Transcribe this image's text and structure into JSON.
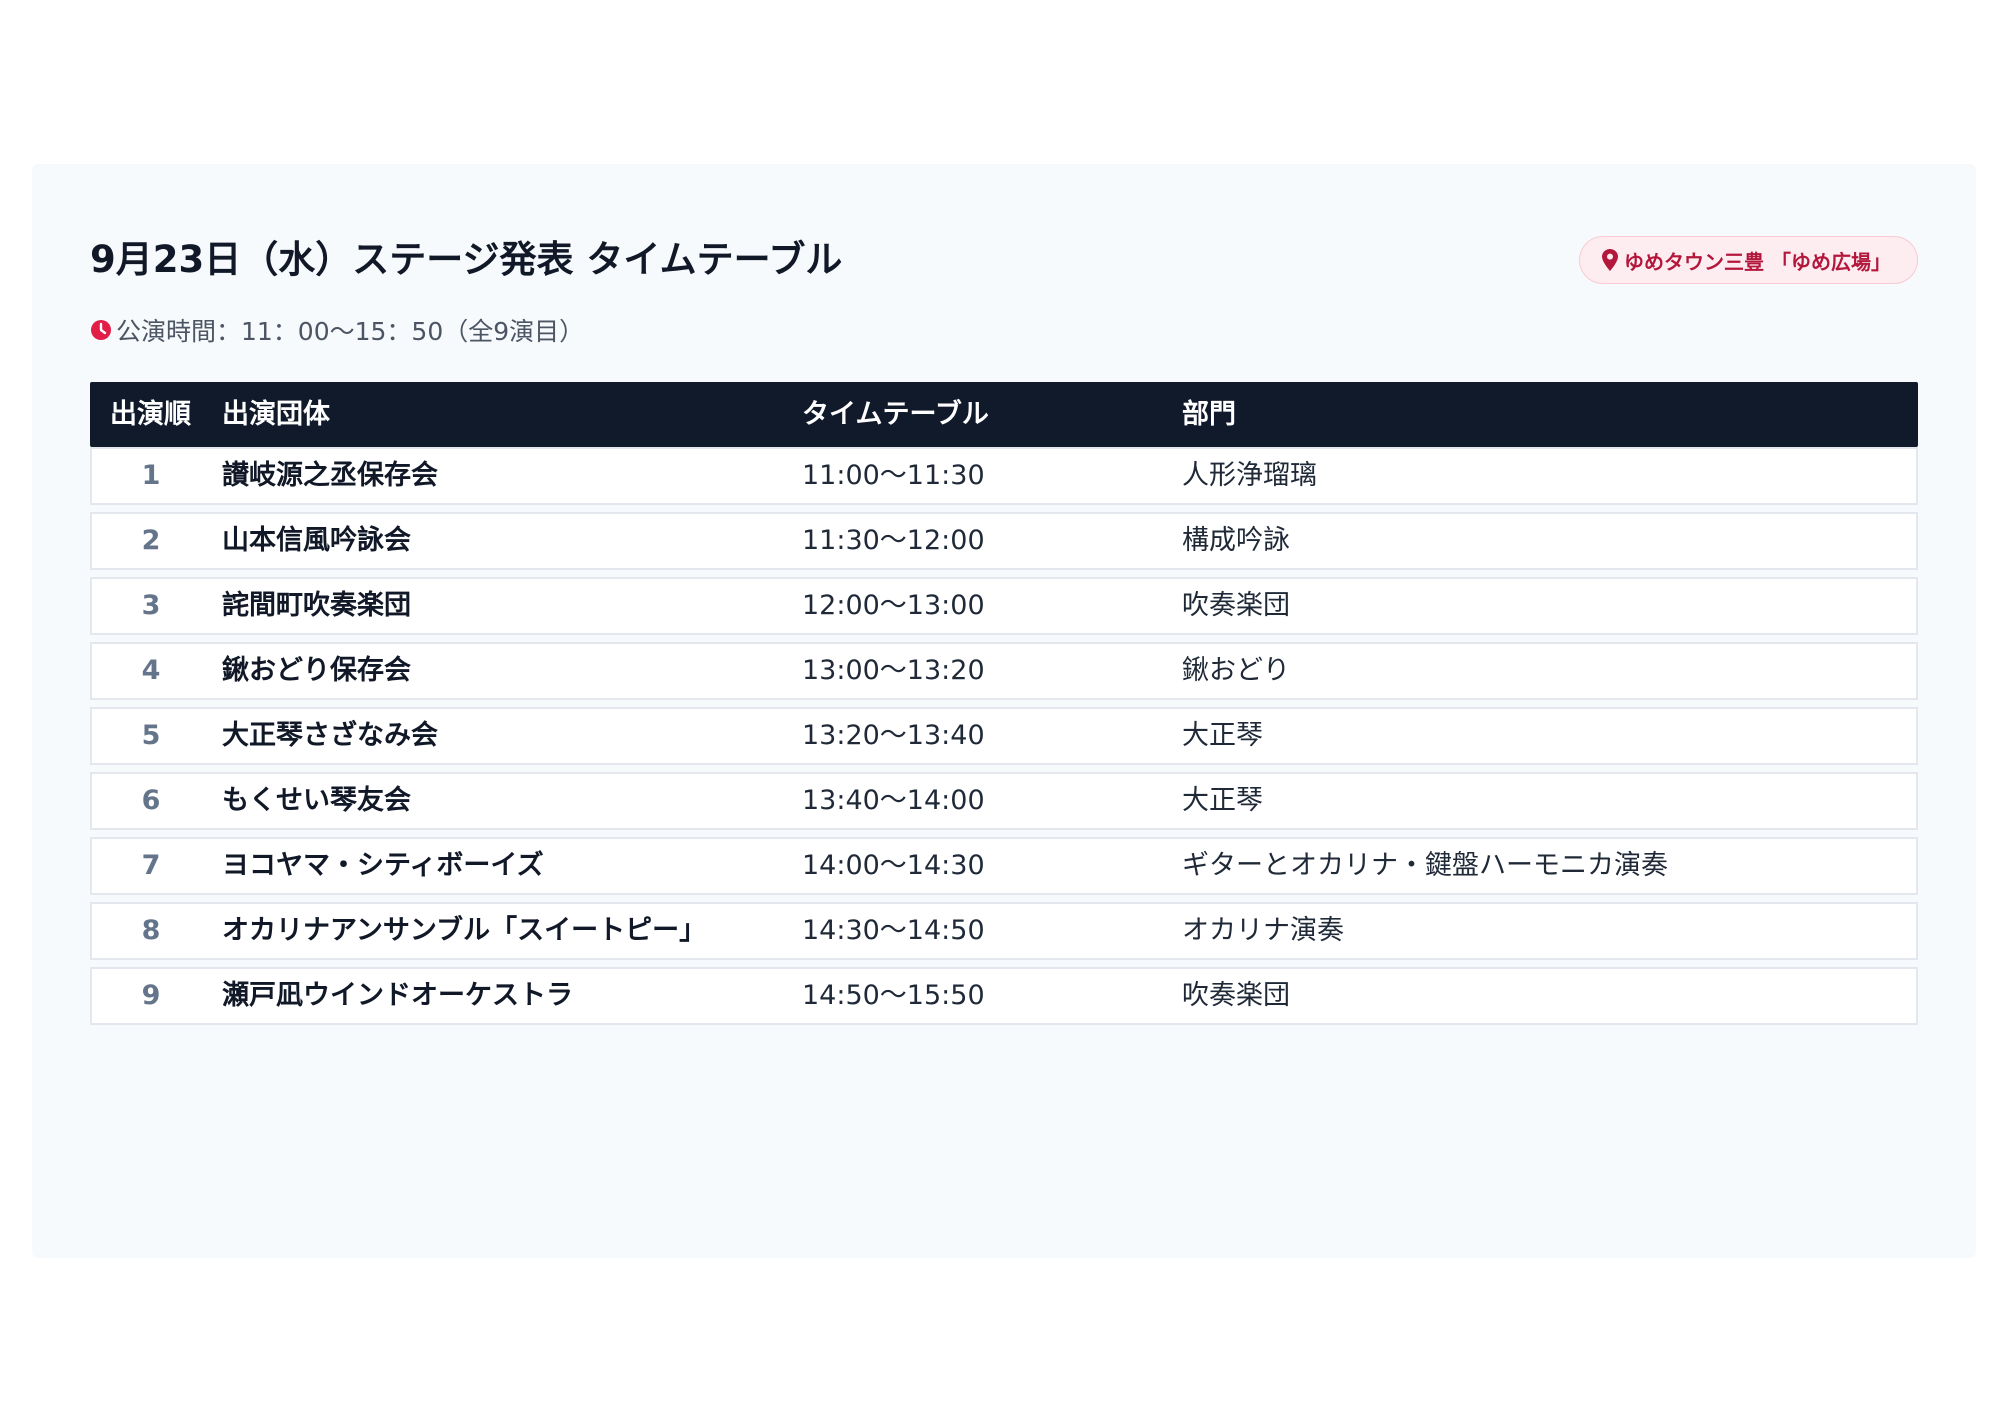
{
  "title": "9月23日（水）ステージ発表 タイムテーブル",
  "venue": {
    "icon": "map-pin-icon",
    "label": "ゆめタウン三豊 「ゆめ広場」"
  },
  "subtitle": {
    "icon": "clock-icon",
    "text": "公演時間：11：00〜15：50（全9演目）"
  },
  "colors": {
    "header_bg": "#111a2b",
    "accent": "#e11d48",
    "badge_text": "#b4173c"
  },
  "table": {
    "headers": {
      "order": "出演順",
      "group": "出演団体",
      "time": "タイムテーブル",
      "genre": "部門"
    },
    "rows": [
      {
        "order": "1",
        "group": "讃岐源之丞保存会",
        "time": "11:00〜11:30",
        "genre": "人形浄瑠璃"
      },
      {
        "order": "2",
        "group": "山本信風吟詠会",
        "time": "11:30〜12:00",
        "genre": "構成吟詠"
      },
      {
        "order": "3",
        "group": "詫間町吹奏楽団",
        "time": "12:00〜13:00",
        "genre": "吹奏楽団"
      },
      {
        "order": "4",
        "group": "鍬おどり保存会",
        "time": "13:00〜13:20",
        "genre": "鍬おどり"
      },
      {
        "order": "5",
        "group": "大正琴さざなみ会",
        "time": "13:20〜13:40",
        "genre": "大正琴"
      },
      {
        "order": "6",
        "group": "もくせい琴友会",
        "time": "13:40〜14:00",
        "genre": "大正琴"
      },
      {
        "order": "7",
        "group": "ヨコヤマ・シティボーイズ",
        "time": "14:00〜14:30",
        "genre": "ギターとオカリナ・鍵盤ハーモニカ演奏"
      },
      {
        "order": "8",
        "group": "オカリナアンサンブル「スイートピー」",
        "time": "14:30〜14:50",
        "genre": "オカリナ演奏"
      },
      {
        "order": "9",
        "group": "瀬戸凪ウインドオーケストラ",
        "time": "14:50〜15:50",
        "genre": "吹奏楽団"
      }
    ]
  }
}
